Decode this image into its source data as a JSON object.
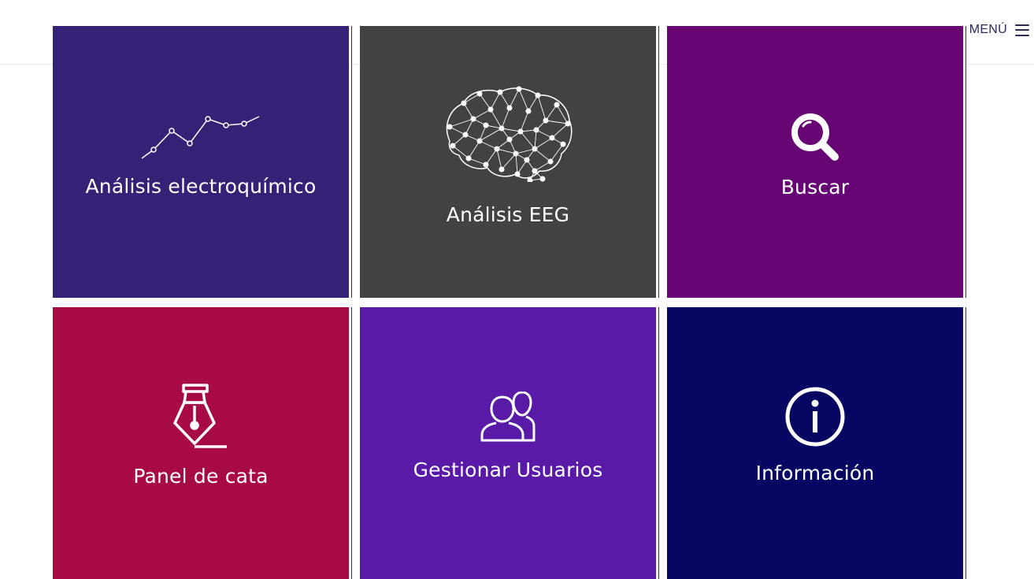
{
  "header": {
    "menu_label": "MENÚ"
  },
  "tiles": [
    {
      "label": "Análisis electroquímico",
      "icon": "line-chart-icon",
      "color": "#352175"
    },
    {
      "label": "Análisis EEG",
      "icon": "brain-network-icon",
      "color": "#424242"
    },
    {
      "label": "Buscar",
      "icon": "search-icon",
      "color": "#680574"
    },
    {
      "label": "Panel de cata",
      "icon": "pen-nib-icon",
      "color": "#a70a44"
    },
    {
      "label": "Gestionar Usuarios",
      "icon": "users-icon",
      "color": "#5a1aa8"
    },
    {
      "label": "Información",
      "icon": "info-icon",
      "color": "#070763"
    }
  ]
}
